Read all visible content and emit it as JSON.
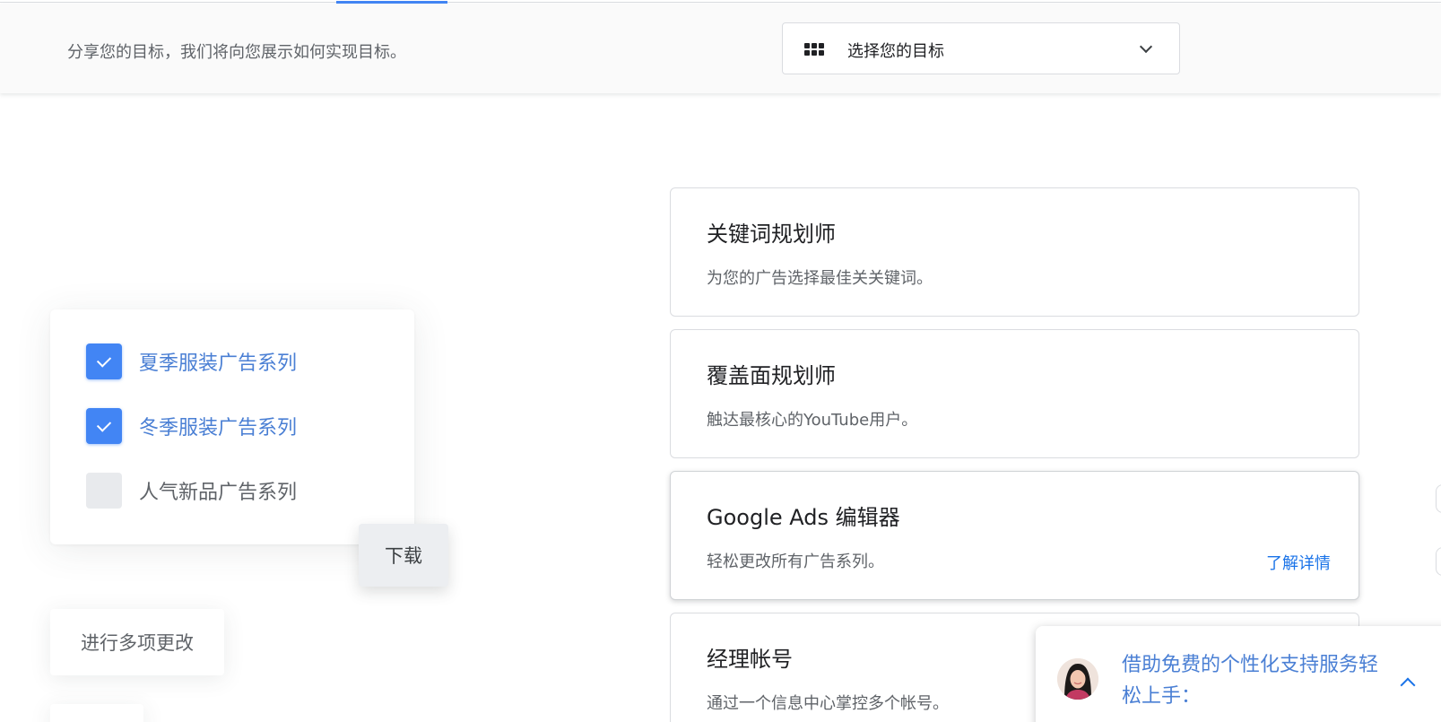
{
  "goal_bar": {
    "prompt": "分享您的目标，我们将向您展示如何实现目标。",
    "select_label": "选择您的目标"
  },
  "campaigns": {
    "items": [
      {
        "label": "夏季服装广告系列",
        "checked": true
      },
      {
        "label": "冬季服装广告系列",
        "checked": true
      },
      {
        "label": "人气新品广告系列",
        "checked": false
      }
    ],
    "download_label": "下载",
    "multi_change_label": "进行多项更改"
  },
  "tools": [
    {
      "title": "关键词规划师",
      "description": "为您的广告选择最佳关关键词。"
    },
    {
      "title": "覆盖面规划师",
      "description": "触达最核心的YouTube用户。"
    },
    {
      "title": "Google Ads 编辑器",
      "description": "轻松更改所有广告系列。",
      "link": "了解详情"
    },
    {
      "title": "经理帐号",
      "description": "通过一个信息中心掌控多个帐号。"
    }
  ],
  "support": {
    "text": "借助免费的个性化支持服务轻松上手："
  },
  "colors": {
    "accent_blue": "#4285f4",
    "link_blue": "#1a73e8",
    "checkbox_label_blue": "#4a7fd4"
  }
}
